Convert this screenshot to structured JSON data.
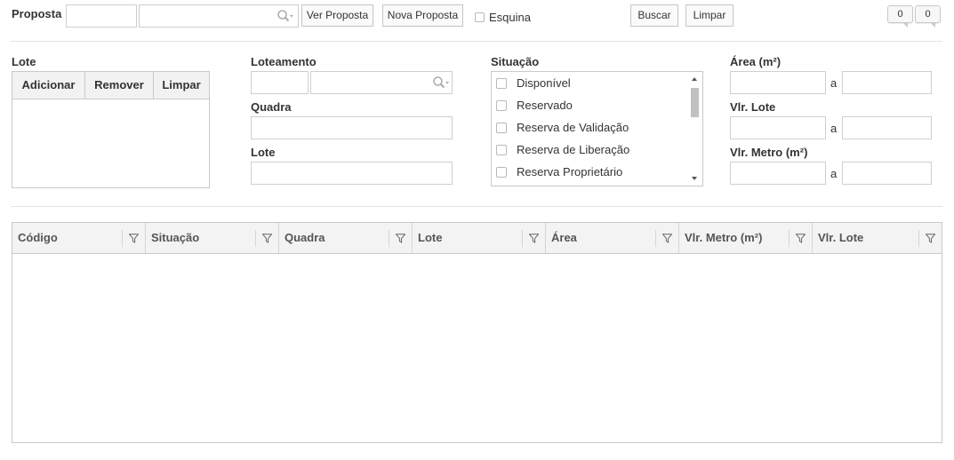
{
  "toolbar": {
    "proposta_label": "Proposta",
    "ver_proposta": "Ver Proposta",
    "nova_proposta": "Nova Proposta",
    "esquina_label": "Esquina",
    "buscar": "Buscar",
    "limpar": "Limpar",
    "badge_left": "0",
    "badge_right": "0"
  },
  "lote_panel": {
    "title": "Lote",
    "buttons": [
      "Adicionar",
      "Remover",
      "Limpar"
    ]
  },
  "filters": {
    "loteamento_label": "Loteamento",
    "quadra_label": "Quadra",
    "lote_label": "Lote"
  },
  "situacao": {
    "label": "Situação",
    "options": [
      "Disponível",
      "Reservado",
      "Reserva de Validação",
      "Reserva de Liberação",
      "Reserva Proprietário"
    ]
  },
  "ranges": {
    "area_label": "Área (m²)",
    "vlr_lote_label": "Vlr. Lote",
    "vlr_metro_label": "Vlr. Metro (m²)",
    "separator": "a"
  },
  "grid": {
    "columns": [
      "Código",
      "Situação",
      "Quadra",
      "Lote",
      "Área",
      "Vlr. Metro (m²)",
      "Vlr. Lote"
    ]
  }
}
